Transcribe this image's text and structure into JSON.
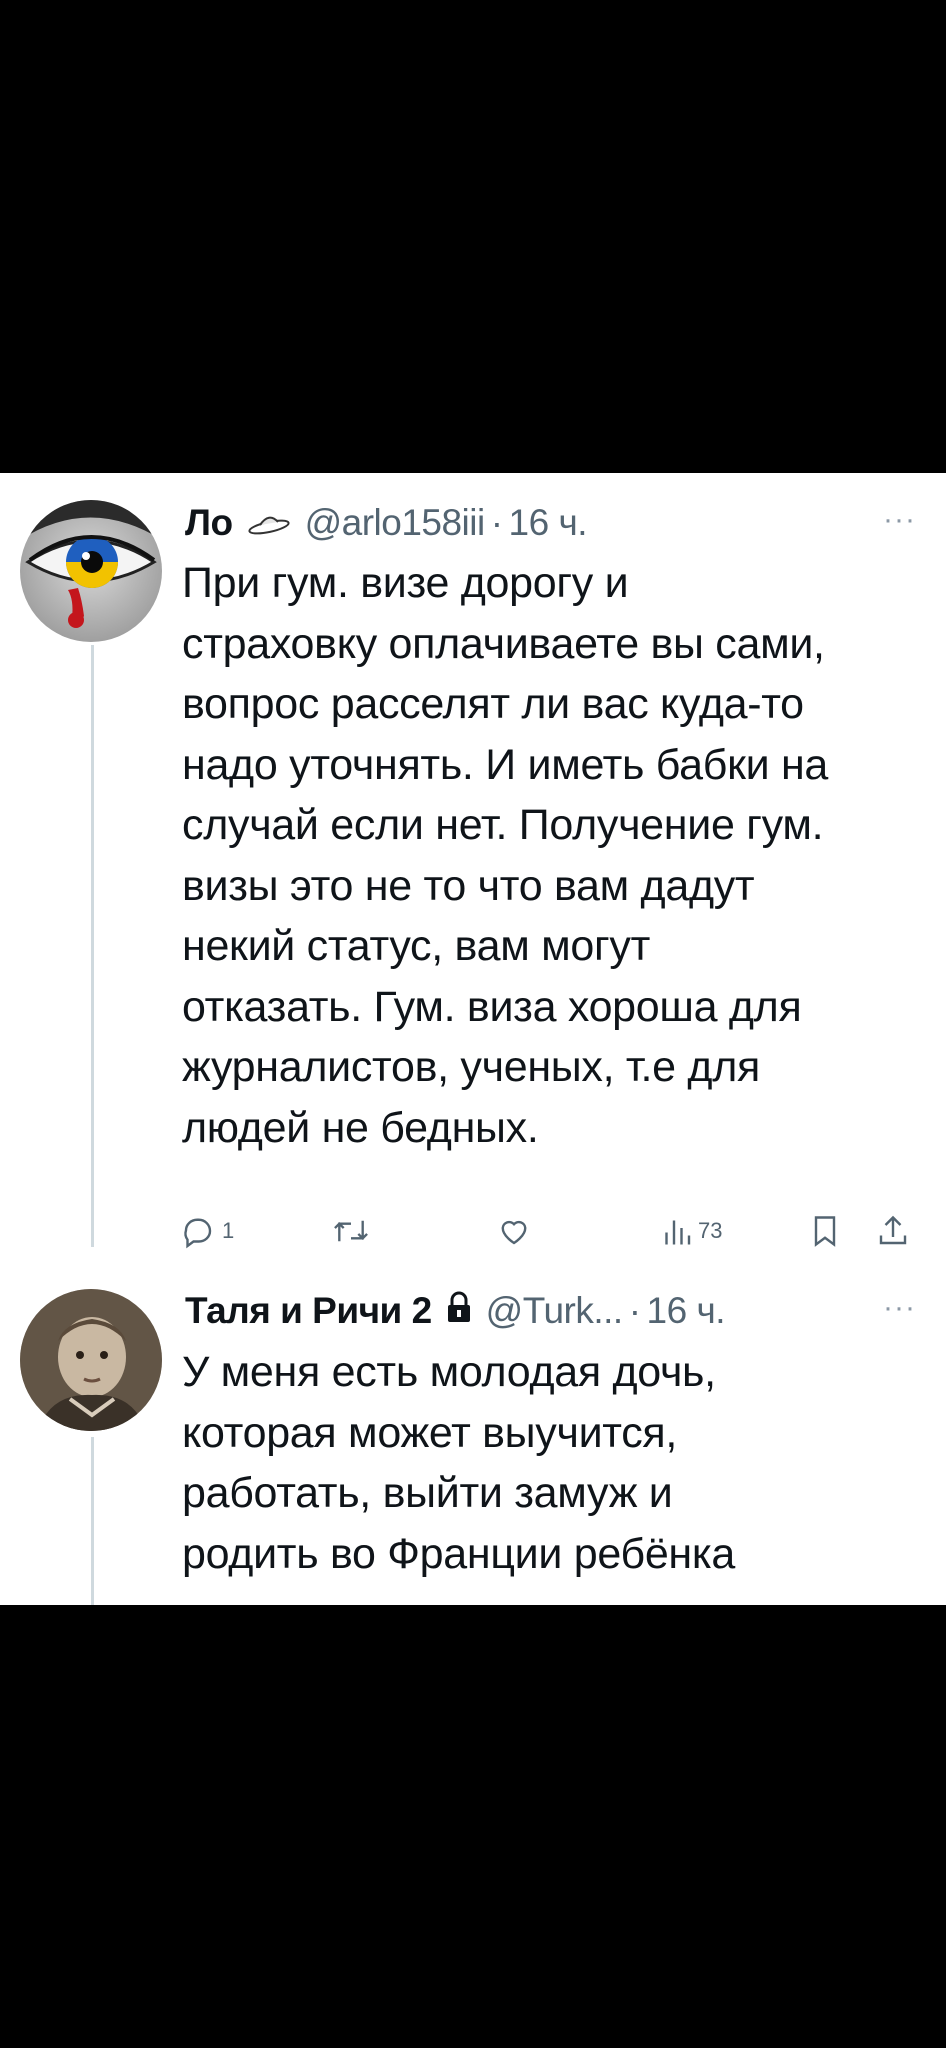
{
  "tweets": [
    {
      "name": "Ло",
      "badge_icon": "ufo-icon",
      "handle": "@arlo158iii",
      "separator": "·",
      "time": "16 ч.",
      "more": "···",
      "text_lines": [
        "При гум. визе дорогу и",
        "страховку оплачиваете вы сами,",
        "вопрос расселят ли вас куда-то",
        "надо уточнять. И иметь бабки на",
        "случай если нет. Получение гум.",
        "визы это не то что вам дадут",
        "некий статус, вам могут",
        "отказать. Гум. виза хороша для",
        "журналистов, ученых,  т.е для",
        "людей не бедных."
      ],
      "actions": {
        "replies": "1",
        "retweets": "",
        "likes": "",
        "views": "73"
      }
    },
    {
      "name": "Таля и Ричи 2",
      "badge_icon": "lock-icon",
      "handle": "@Turk...",
      "separator": "·",
      "time": "16 ч.",
      "more": "···",
      "text_lines": [
        "У меня есть молодая дочь,",
        "которая может выучится,",
        "работать, выйти замуж и",
        "родить во Франции ребёнка"
      ]
    }
  ],
  "colors": {
    "text_primary": "#0f1419",
    "text_secondary": "#536471",
    "thread_line": "#cfd9de",
    "background": "#ffffff",
    "letterbox": "#000000"
  }
}
